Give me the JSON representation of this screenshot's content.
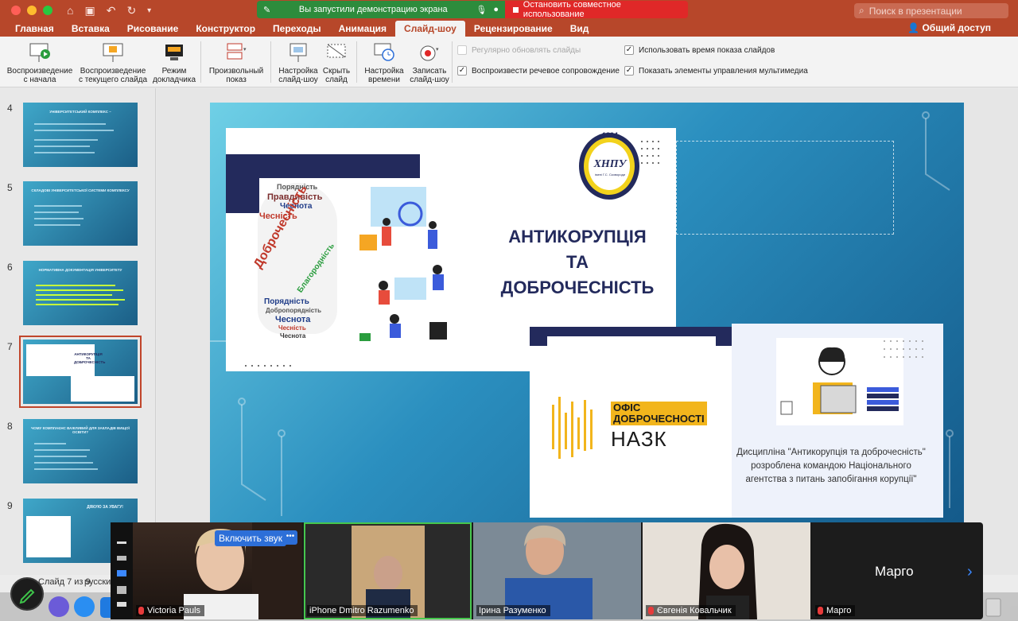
{
  "titlebar": {
    "share_message": "Вы запустили демонстрацию экрана",
    "stop_share": "Остановить совместное использование",
    "search_placeholder": "Поиск в презентации"
  },
  "tabs": [
    "Главная",
    "Вставка",
    "Рисование",
    "Конструктор",
    "Переходы",
    "Анимация",
    "Слайд-шоу",
    "Рецензирование",
    "Вид"
  ],
  "active_tab": "Слайд-шоу",
  "share_access": "Общий доступ",
  "ribbon": {
    "play_from_start": [
      "Воспроизведение",
      "с начала"
    ],
    "play_from_current": [
      "Воспроизведение",
      "с текущего слайда"
    ],
    "presenter_mode": [
      "Режим",
      "докладчика"
    ],
    "custom_show": [
      "Произвольный",
      "показ"
    ],
    "setup_show": [
      "Настройка",
      "слайд-шоу"
    ],
    "hide_slide": [
      "Скрыть",
      "слайд"
    ],
    "rehearse": [
      "Настройка",
      "времени"
    ],
    "record": [
      "Записать",
      "слайд-шоу"
    ],
    "checkboxes": {
      "auto_update": "Регулярно обновлять слайды",
      "play_narration": "Воспроизвести речевое сопровождение",
      "use_timings": "Использовать время показа слайдов",
      "show_media_controls": "Показать элементы управления мультимедиа"
    }
  },
  "thumbnails": [
    {
      "num": "4",
      "title": "УНІВЕРСИТЕТСЬКИЙ КОМПЛЕКС –"
    },
    {
      "num": "5",
      "title": "СКЛАДОВІ УНІВЕРСИТЕТСЬКОЇ СИСТЕМИ КОМПЛЕКСУ"
    },
    {
      "num": "6",
      "title": "НОРМАТИВНА ДОКУМЕНТАЦІЯ УНІВЕРСИТЕТУ"
    },
    {
      "num": "7",
      "title": "АНТИКОРУПЦІЯ ТА ДОБРОЧЕСНІСТЬ"
    },
    {
      "num": "8",
      "title": "ЧОМУ КОМПЛАЄНС ВАЖЛИВИЙ ДЛЯ ЗАКЛАДІВ ВИЩОЇ ОСВІТИ?"
    },
    {
      "num": "9",
      "title": "ДЯКУЮ ЗА УВАГУ!"
    }
  ],
  "slide": {
    "title_lines": [
      "АНТИКОРУПЦІЯ",
      "ТА",
      "ДОБРОЧЕСНІСТЬ"
    ],
    "seal_year": "1804",
    "seal_text": "ХНПУ",
    "seal_sub": "імені Г.С. Сковороди",
    "office_line1": "ОФІС",
    "office_line2": "ДОБРОЧЕСНОСТІ",
    "nazk": "НАЗК",
    "description": "Дисципліна \"Антикорупція та доброчесність\" розроблена командою Національного агентства з питань запобігання корупції\"",
    "word_cloud": [
      "Порядність",
      "Правдивість",
      "Чеснота",
      "Чесність",
      "Доброчесність",
      "Благородність",
      "Порядність",
      "Добропорядність",
      "Чеснота",
      "Чесність",
      "Чеснота"
    ]
  },
  "status": {
    "slide_counter": "Слайд 7 из 9",
    "language": "русский"
  },
  "meeting": {
    "unmute": "Включить звук",
    "participants": [
      "Victoria Pauls",
      "iPhone Dmitro Razumenko",
      "Ірина Разуменко",
      "Євгенія Ковальчик",
      "Марго"
    ],
    "margo_big": "Марго"
  },
  "colors": {
    "accent": "#b7472a",
    "navy": "#232a5c",
    "share_green": "#2d8c3c",
    "share_red": "#e02828",
    "zoom_blue": "#2d6fd8"
  }
}
